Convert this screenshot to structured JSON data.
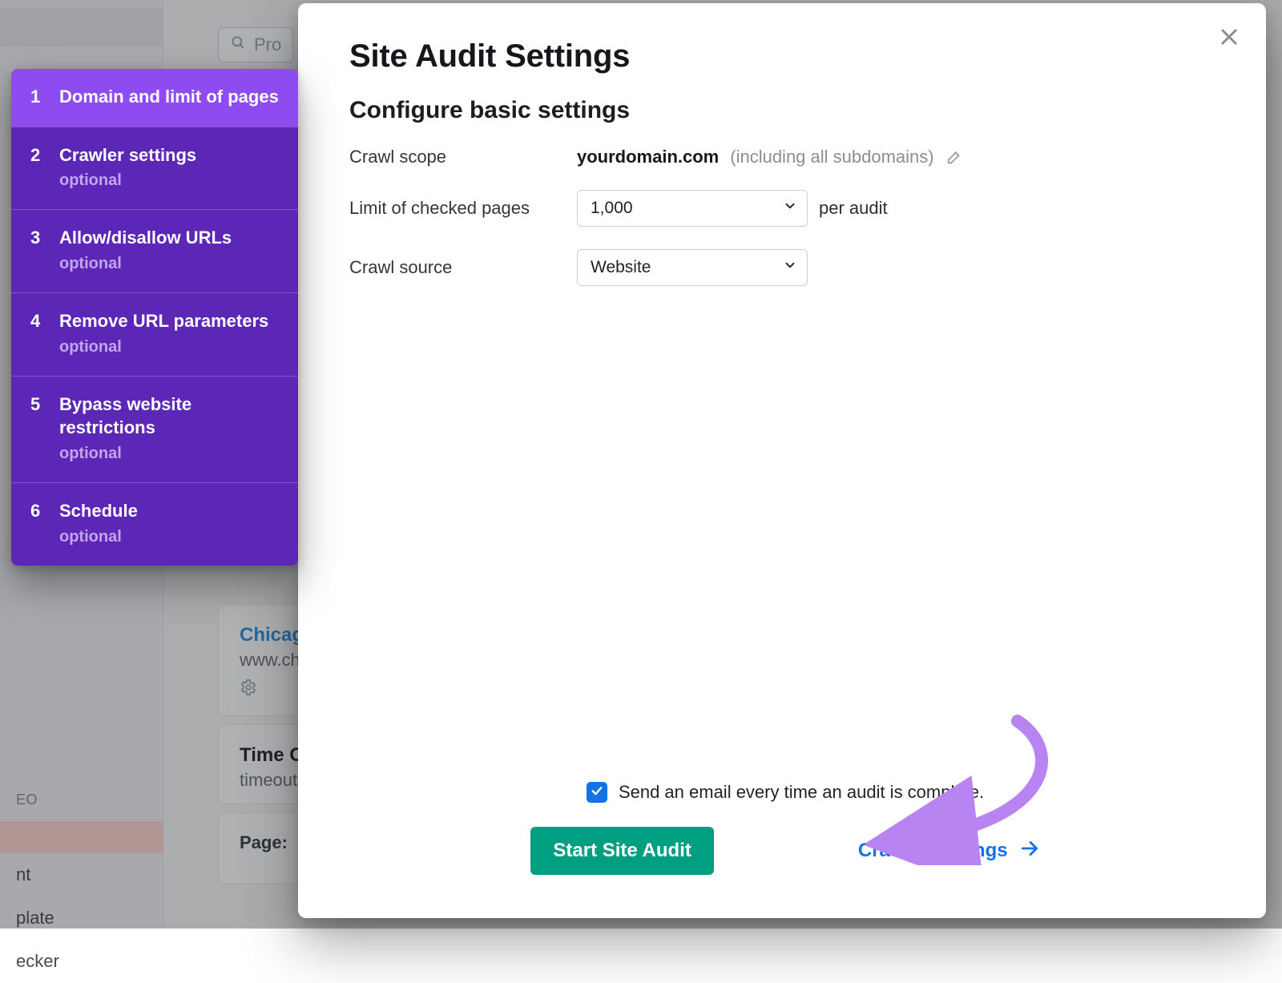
{
  "background": {
    "search_placeholder": "Pro",
    "sidebar_items": [
      "nt",
      "plate",
      "ecker"
    ],
    "sidebar_section": "EO",
    "card1_link": "Chicago",
    "card1_sub": "www.ch",
    "card2_title": "Time Ou",
    "card2_sub": "timeout",
    "page_label": "Page:"
  },
  "steps": [
    {
      "num": "1",
      "title": "Domain and limit of pages",
      "optional": ""
    },
    {
      "num": "2",
      "title": "Crawler settings",
      "optional": "optional"
    },
    {
      "num": "3",
      "title": "Allow/disallow URLs",
      "optional": "optional"
    },
    {
      "num": "4",
      "title": "Remove URL parameters",
      "optional": "optional"
    },
    {
      "num": "5",
      "title": "Bypass website restrictions",
      "optional": "optional"
    },
    {
      "num": "6",
      "title": "Schedule",
      "optional": "optional"
    }
  ],
  "modal": {
    "title": "Site Audit Settings",
    "subtitle": "Configure basic settings",
    "crawl_scope_label": "Crawl scope",
    "crawl_scope_domain": "yourdomain.com",
    "crawl_scope_hint": "(including all subdomains)",
    "limit_label": "Limit of checked pages",
    "limit_value": "1,000",
    "limit_unit": "per audit",
    "source_label": "Crawl source",
    "source_value": "Website",
    "email_checkbox_label": "Send an email every time an audit is complete.",
    "start_button": "Start Site Audit",
    "next_link": "Crawler settings"
  }
}
